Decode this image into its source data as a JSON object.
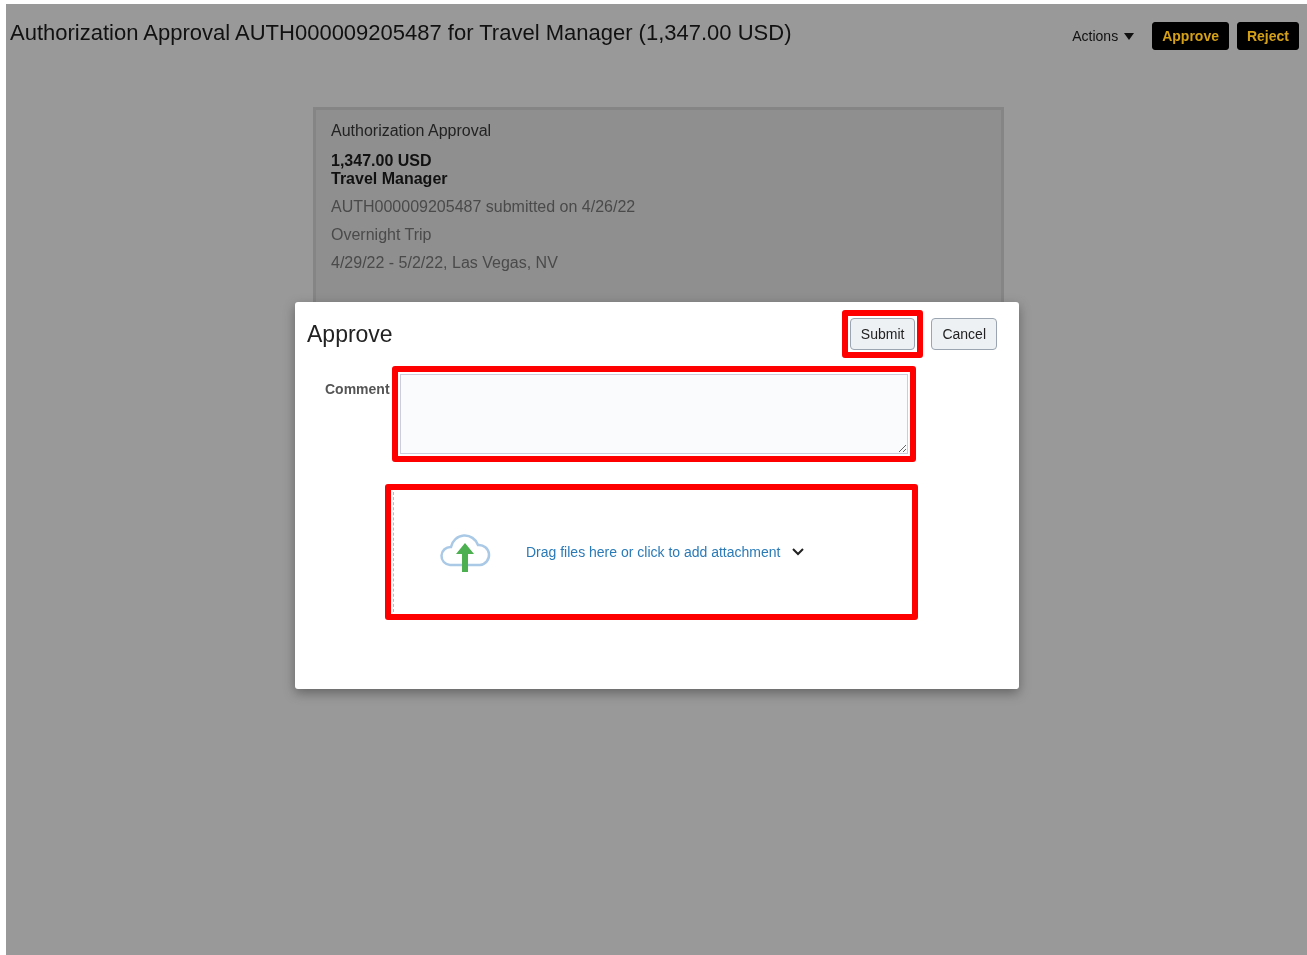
{
  "header": {
    "title": "Authorization Approval AUTH000009205487 for Travel Manager (1,347.00 USD)",
    "actions": "Actions",
    "buttons": [
      "Approve",
      "Reject"
    ]
  },
  "card": {
    "title": "Authorization Approval",
    "amount": "1,347.00 USD",
    "name": "Travel Manager",
    "lines": [
      "AUTH000009205487 submitted on 4/26/22",
      "Overnight Trip",
      "4/29/22 - 5/2/22, Las Vegas, NV"
    ]
  },
  "dialog": {
    "title": "Approve",
    "buttons": [
      {
        "label": "Submit",
        "highlighted": true
      },
      {
        "label": "Cancel",
        "highlighted": false
      }
    ],
    "comment": {
      "label": "Comment",
      "highlighted": true
    },
    "attachment": {
      "text": "Drag files here or click to add attachment",
      "highlighted": true
    }
  }
}
